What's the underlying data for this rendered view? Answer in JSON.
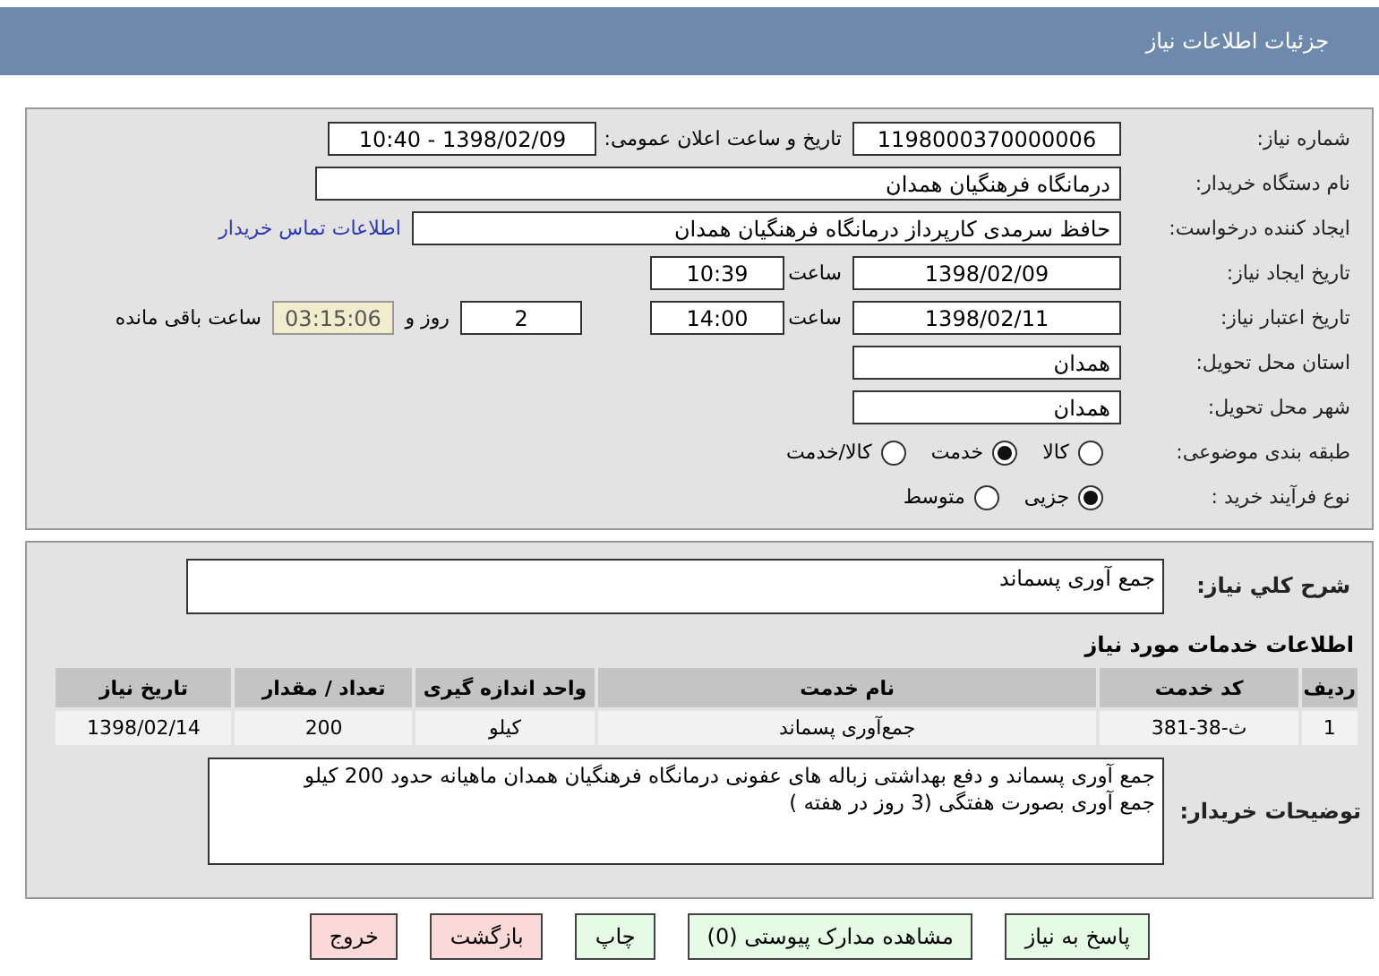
{
  "page_title": "جزئیات اطلاعات نیاز",
  "details": {
    "need_number": {
      "label": "شماره نیاز:",
      "value": "1198000370000006"
    },
    "announce": {
      "label": "تاریخ و ساعت اعلان عمومی:",
      "value": "1398/02/09 - 10:40"
    },
    "buyer": {
      "label": "نام دستگاه خریدار:",
      "value": "درمانگاه فرهنگیان همدان"
    },
    "creator": {
      "label": "ایجاد کننده درخواست:",
      "value": "حافظ سرمدی کارپرداز درمانگاه فرهنگیان همدان",
      "link": "اطلاعات تماس خریدار"
    },
    "created": {
      "label": "تاریخ ایجاد نیاز:",
      "date": "1398/02/09",
      "time_label": "ساعت",
      "time": "10:39"
    },
    "validity": {
      "label": "تاریخ اعتبار نیاز:",
      "date": "1398/02/11",
      "time_label": "ساعت",
      "time": "14:00",
      "days": "2",
      "days_label": "روز و",
      "remaining": "03:15:06",
      "remaining_label": "ساعت باقی مانده"
    },
    "province": {
      "label": "استان محل تحویل:",
      "value": "همدان"
    },
    "city": {
      "label": "شهر محل تحویل:",
      "value": "همدان"
    },
    "category": {
      "label": "طبقه بندی موضوعی:",
      "options": [
        {
          "label": "کالا",
          "selected": false
        },
        {
          "label": "خدمت",
          "selected": true
        },
        {
          "label": "کالا/خدمت",
          "selected": false
        }
      ]
    },
    "process": {
      "label": "نوع فرآیند خرید :",
      "options": [
        {
          "label": "جزیی",
          "selected": true
        },
        {
          "label": "متوسط",
          "selected": false
        }
      ]
    }
  },
  "summary": {
    "label": "شرح کلي نیاز:",
    "value": "جمع آوری پسماند"
  },
  "services": {
    "title": "اطلاعات خدمات مورد نیاز",
    "columns": [
      "ردیف",
      "کد خدمت",
      "نام خدمت",
      "واحد اندازه گیری",
      "تعداد / مقدار",
      "تاریخ نیاز"
    ],
    "rows": [
      [
        "1",
        "ث-38-381",
        "جمع‌آوری پسماند",
        "کیلو",
        "200",
        "1398/02/14"
      ]
    ]
  },
  "buyer_notes": {
    "label": "توضیحات خریدار:",
    "value": "جمع آوری پسماند و دفع بهداشتی زباله های عفونی درمانگاه فرهنگیان همدان ماهیانه حدود 200 کیلو\nجمع آوری بصورت هفتگی (3 روز در هفته )"
  },
  "buttons": [
    {
      "label": "پاسخ به نیاز",
      "kind": "action"
    },
    {
      "label": "مشاهده مدارک پیوستی (0)",
      "kind": "action"
    },
    {
      "label": "چاپ",
      "kind": "action"
    },
    {
      "label": "بازگشت",
      "kind": "exit"
    },
    {
      "label": "خروج",
      "kind": "exit"
    }
  ]
}
